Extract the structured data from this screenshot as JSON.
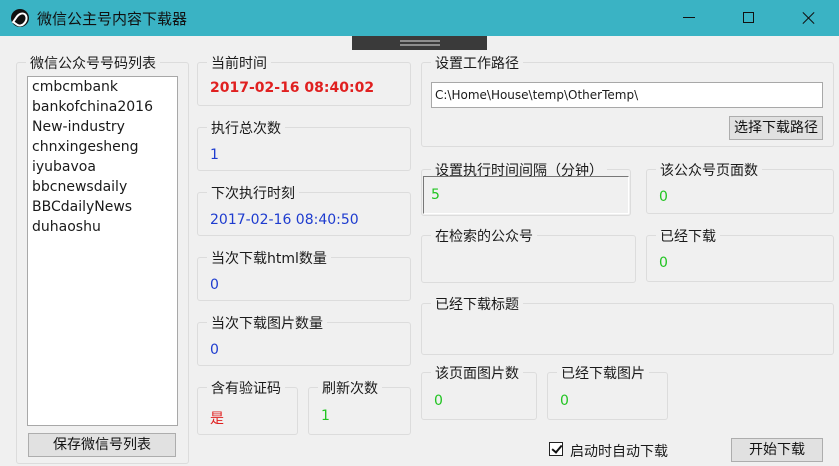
{
  "window": {
    "title": "微信公主号内容下载器",
    "controls": {
      "minimize": "minimize-icon",
      "maximize": "maximize-icon",
      "close": "close-icon"
    }
  },
  "left_panel": {
    "label": "微信公众号号码列表",
    "accounts": [
      "cmbcmbank",
      "bankofchina2016",
      "New-industry",
      "chnxingesheng",
      "iyubavoa",
      "bbcnewsdaily",
      "BBCdailyNews",
      "duhaoshu"
    ],
    "save_button": "保存微信号列表"
  },
  "stats": {
    "current_time_label": "当前时间",
    "current_time": "2017-02-16 08:40:02",
    "total_runs_label": "执行总次数",
    "total_runs": "1",
    "next_run_label": "下次执行时刻",
    "next_run": "2017-02-16 08:40:50",
    "html_count_label": "当次下载html数量",
    "html_count": "0",
    "image_count_label": "当次下载图片数量",
    "image_count": "0",
    "captcha_label": "含有验证码",
    "captcha_value": "是",
    "refresh_label": "刷新次数",
    "refresh_count": "1"
  },
  "settings": {
    "workpath_label": "设置工作路径",
    "workpath": "C:\\Home\\House\\temp\\OtherTemp\\",
    "choose_path_button": "选择下载路径",
    "interval_label": "设置执行时间间隔（分钟）",
    "interval": "5",
    "page_count_label": "该公众号页面数",
    "page_count": "0",
    "searching_label": "在检索的公众号",
    "searching_value": "",
    "downloaded_label": "已经下载",
    "downloaded": "0",
    "downloaded_title_label": "已经下载标题",
    "downloaded_title": "",
    "page_images_label": "该页面图片数",
    "page_images": "0",
    "downloaded_images_label": "已经下载图片",
    "downloaded_images": "0",
    "autostart_label": "启动时自动下载",
    "autostart_checked": true,
    "start_button": "开始下载"
  }
}
